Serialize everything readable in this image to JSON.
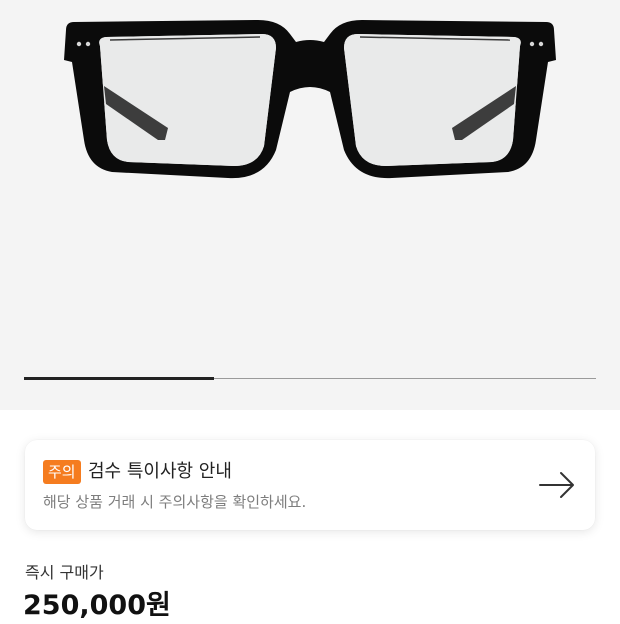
{
  "product_gallery": {
    "image": "black-square-eyeglasses",
    "background_color": "#f4f4f4",
    "slide_progress": 0.333
  },
  "notice": {
    "badge": "주의",
    "badge_color": "#f57c1f",
    "title": "검수 특이사항 안내",
    "description": "해당 상품 거래 시 주의사항을 확인하세요.",
    "icon": "arrow-right-icon"
  },
  "price": {
    "label": "즉시 구매가",
    "value": "250,000원"
  }
}
